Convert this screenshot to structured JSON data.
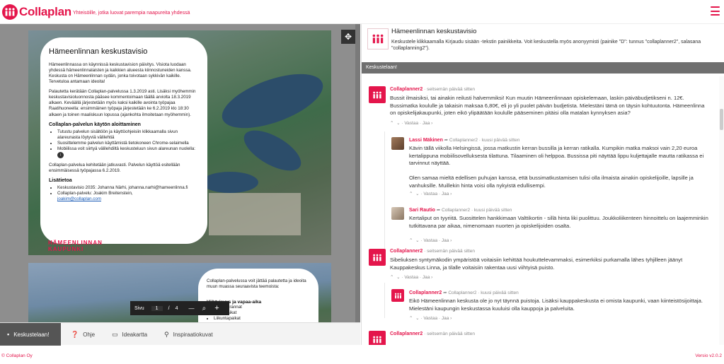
{
  "header": {
    "brand": "Collaplan",
    "tagline": "Yhteisöille, jotka luovat parempia naapureita yhdessä"
  },
  "document": {
    "title": "Hämeenlinnan keskustavisio",
    "p1": "Hämeenlinnassa on käynnissä keskustavision päivitys. Visiota luodaan yhdessä hämeenlinnalaisten ja kaikkien alueesta kiinnostuneiden kanssa. Keskusta on Hämeenlinnan sydän, jonka toivotaan sykkivän kaikille. Tervetuloa antamaan ideoita!",
    "p2": "Palautetta kerätään Collaplan-palvelussa 1.3.2019 asti. Lisäksi myöhemmin keskustavisioluonnosta pääsee kommentoimaan täällä arviolta 18.3.2019 alkaen. Keväällä järjestetään myös kaksi kaikille avointa työpajaa Raatihuoneella: ensimmäinen työpaja järjestetään ke 6.2.2019 klo 18:30 alkaen ja toinen maaliskuun lopussa (ajankohta ilmoitetaan myöhemmin).",
    "h_start": "Collaplan-palvelun käytön aloittaminen",
    "start_items": [
      "Tutustu palvelun sisältöön ja käyttöohjeisiin klikkaamalla sivun alareunasta löytyviä välilehtiä",
      "Suosittelemme palvelun käyttämistä tietokoneen Chrome-selaimella",
      "Mobiilissa voit siirtyä välilehdiltä keskusteluun sivun alareunan nuolella:"
    ],
    "p3": "Collaplan-palvelua kehitetään jatkuvasti. Palvelun käyttöä esitellään ensimmäisessä työpajassa 6.2.2019.",
    "h_info": "Lisätietoa",
    "info_items": [
      "Keskustavisio 2035: Johanna Närhi, johanna.narhi@hameenlinna.fi",
      "Collaplan-palvelu: Joakim Breitenstein,"
    ],
    "info_link": "joakim@collaplan.com",
    "city_logo_1": "HÄMEENLINNAN",
    "city_logo_2": "KAUPUNKI",
    "page2_text": "Collaplan-palvelussa voit jättää palautetta ja ideoita muun muassa seuraavista teemoista:",
    "page2_heading": "Viihtyisyys ja vapaa-aika",
    "page2_items": [
      "Puistot, rannat",
      "Leikkipaikat",
      "Liikuntapaikat"
    ]
  },
  "pager": {
    "label": "Sivu",
    "current": "1",
    "separator": "/",
    "total": "4",
    "zoom_out": "—",
    "zoom_in": "+"
  },
  "tabs": [
    {
      "label": "Keskustelaan!",
      "icon": "chat-icon",
      "active": true
    },
    {
      "label": "Ohje",
      "icon": "help-icon",
      "active": false
    },
    {
      "label": "Ideakartta",
      "icon": "map-icon",
      "active": false
    },
    {
      "label": "Inspiraatiokuvat",
      "icon": "lightbulb-icon",
      "active": false
    }
  ],
  "topic": {
    "title": "Hämeenlinnan keskustavisio",
    "description": "Keskustele klikkaamalla Kirjaudu sisään -tekstin painikkeita. Voit keskustella myös anonyymisti (painike \"D\": tunnus \"collaplanner2\", salasana \"collaplanning2\")."
  },
  "section_label": "Keskustelaan!",
  "comments": [
    {
      "author": "Collaplanner2",
      "reply_to": "",
      "time": "· seitsemän päivää sitten",
      "body": "Bussit ilmaisiksi, tai ainakin reilusti halvemmiksi! Kun muutin Hämeenlinnaan opiskelemaan, laskin päiväbudjetikseni n. 12€. Bussimatka koululle ja takaisin maksaa 6,80€, eli jo yli puolet päivän budjetista. Mielestäni tämä on täysin kohtuutonta. Hämeenlinna on opiskelijakaupunki, joten eikö ylipäätään koululle pääseminen pitäisi olla matalan kynnyksen asia?",
      "reply": "Vastaa",
      "share": "Jaa"
    },
    {
      "author": "Lassi Mäkinen",
      "reply_to": "➦ Collaplanner2",
      "time": "· kuusi päivää sitten",
      "body": "Kävin tällä viikolla Helsingissä, jossa matkustin kerran bussilla ja kerran ratikalla. Kumpikin matka maksoi vain 2,20 euroa kertalippuna mobiilisovelluksesta tilattuna. Tilaaminen oli helppoa. Bussissa piti näyttää lippu kuljettajalle mautta ratikassa ei tarvinnut näyttää.",
      "body2": "Olen samaa mieltä edellisen puhujan kanssa, että bussimatkustamisen tulisi olla ilmaista ainakin opiskelijoille, lapsille ja vanhuksille. Muillekin hinta voisi olla nykyistä edullisempi.",
      "reply": "Vastaa",
      "share": "Jaa"
    },
    {
      "author": "Sari Rautio",
      "reply_to": "➦ Collaplanner2",
      "time": "· kuusi päivää sitten",
      "body": "Kertaliput on tyyriitä. Suosittelen hankkimaan Valttikortin - sillä hinta liki puolittuu. Joukkoliikenteen hinnoittelu on laajemminkin tutkittavana par aikaa, nimenomaan nuorten ja opiskelijoiden osalta.",
      "reply": "Vastaa",
      "share": "Jaa"
    },
    {
      "author": "Collaplanner2",
      "reply_to": "",
      "time": "· seitsemän päivää sitten",
      "body": "Sibeliuksen syntymäkodin ympäristöä voitaisiin kehittää houkuttelevammaksi, esimerkiksi purkamalla lähes tyhjilleen jäänyt Kauppakeskus Linna, ja tilalle voitaisiin rakentaa uusi viihtyisä puisto.",
      "reply": "Vastaa",
      "share": "Jaa"
    },
    {
      "author": "Collaplanner2",
      "reply_to": "➦ Collaplanner2",
      "time": "· kuusi päivää sitten",
      "body": "Eikö Hämeenlinnan keskusta ole jo nyt täynnä puistoja. Lisäksi kauppakeskusta ei omista kaupunki, vaan kiinteistösijoittaja. Mielestäni kaupungin keskustassa kuuluisi olla kauppoja ja palveluita.",
      "reply": "Vastaa",
      "share": "Jaa"
    },
    {
      "author": "Collaplanner2",
      "reply_to": "",
      "time": "· seitsemän päivää sitten",
      "body": "",
      "reply": "Vastaa",
      "share": "Jaa"
    }
  ],
  "footer": {
    "copyright": "© Collaplan Oy",
    "version": "Versio v2.0.2"
  },
  "colors": {
    "brand": "#e4154b"
  }
}
